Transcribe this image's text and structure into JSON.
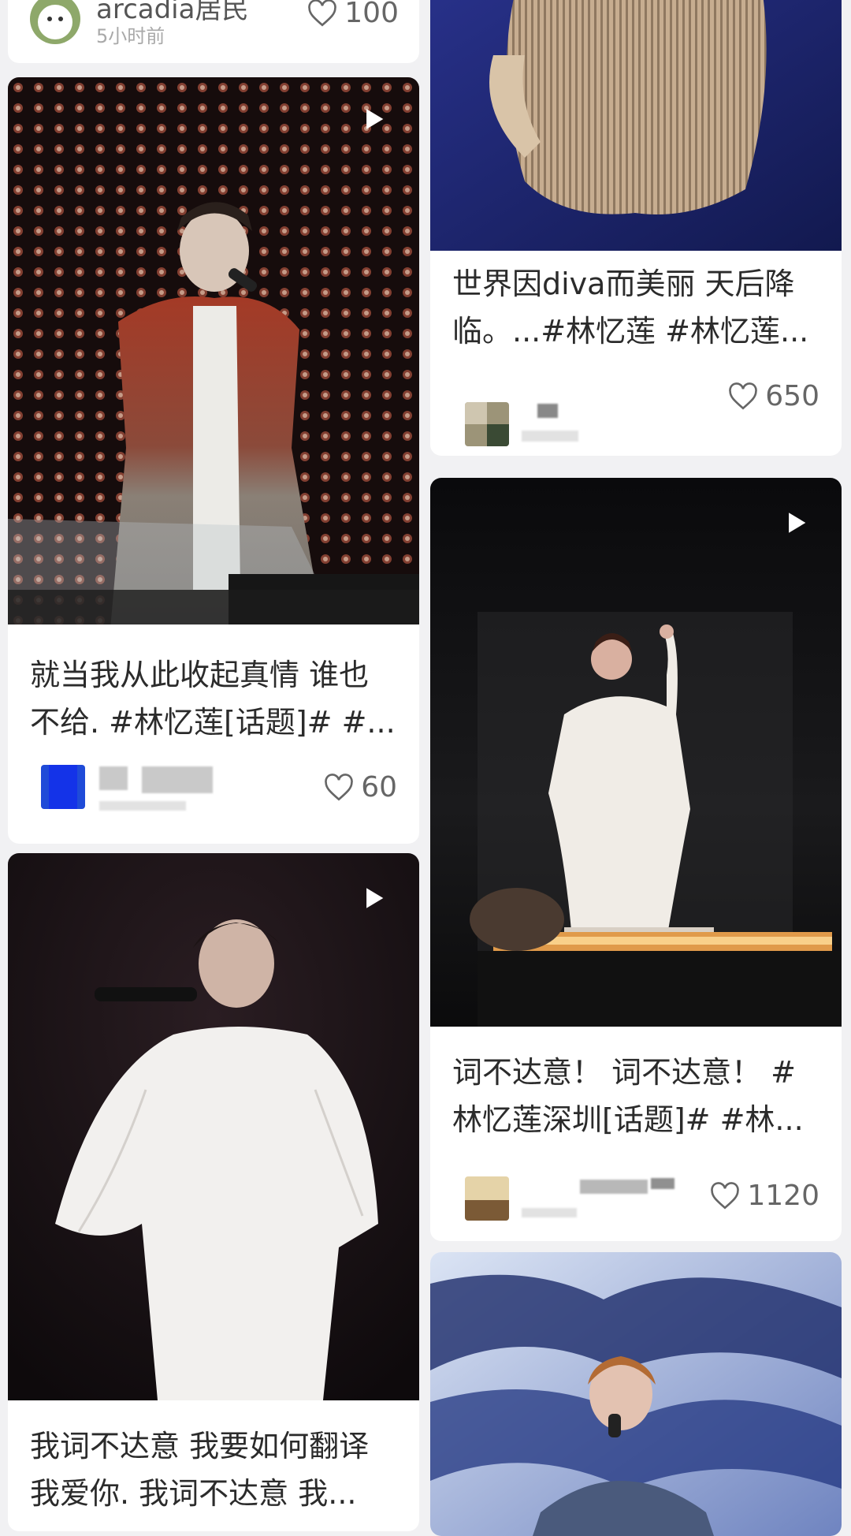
{
  "top_card": {
    "author_name": "arcadia居民",
    "time": "5小时前",
    "likes": "100"
  },
  "cards": [
    {
      "title": "就当我从此收起真情 谁也不给. #林忆莲[话题]# #...",
      "likes": "60",
      "has_video": true
    },
    {
      "title": "我词不达意 我要如何翻译我爱你. 我词不达意 我...",
      "likes": "",
      "has_video": true
    },
    {
      "title": "世界因diva而美丽 天后降临。...#林忆莲 #林忆莲...",
      "likes": "650",
      "has_video": false
    },
    {
      "title": "词不达意！ 词不达意！ #林忆莲深圳[话题]# #林...",
      "likes": "1120",
      "has_video": true
    }
  ],
  "colors": {
    "background": "#f1f1f3",
    "card": "#ffffff",
    "text": "#2b2b2b",
    "muted": "#a9a9a9",
    "like_icon": "#666666"
  },
  "icons": [
    "heart-outline-icon",
    "play-icon"
  ]
}
